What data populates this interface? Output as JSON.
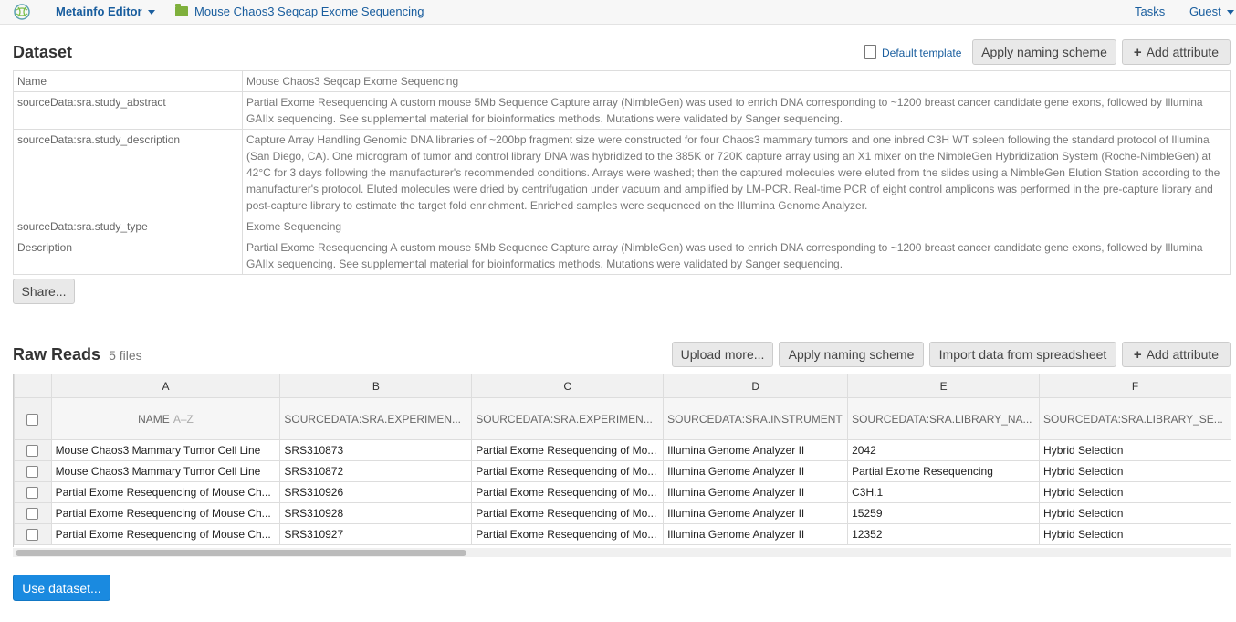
{
  "topbar": {
    "app_menu": "Metainfo Editor",
    "project": "Mouse Chaos3 Seqcap Exome Sequencing",
    "tasks": "Tasks",
    "user": "Guest"
  },
  "dataset": {
    "title": "Dataset",
    "default_template": "Default template",
    "apply_naming": "Apply naming scheme",
    "add_attribute": "Add attribute",
    "attributes": [
      {
        "key": "Name",
        "value": "Mouse Chaos3 Seqcap Exome Sequencing"
      },
      {
        "key": "sourceData:sra.study_abstract",
        "value": "Partial Exome Resequencing A custom mouse 5Mb Sequence Capture array (NimbleGen) was used to enrich DNA corresponding to ~1200 breast cancer candidate gene exons, followed by Illumina GAIIx sequencing. See supplemental material for bioinformatics methods. Mutations were validated by Sanger sequencing."
      },
      {
        "key": "sourceData:sra.study_description",
        "value": "Capture Array Handling Genomic DNA libraries of ~200bp fragment size were constructed for four Chaos3 mammary tumors and one inbred C3H WT spleen following the standard protocol of Illumina (San Diego, CA). One microgram of tumor and control library DNA was hybridized to the 385K or 720K capture array using an X1 mixer on the NimbleGen Hybridization System (Roche-NimbleGen) at 42°C for 3 days following the manufacturer's recommended conditions. Arrays were washed; then the captured molecules were eluted from the slides using a NimbleGen Elution Station according to the manufacturer's protocol. Eluted molecules were dried by centrifugation under vacuum and amplified by LM-PCR. Real-time PCR of eight control amplicons was performed in the pre-capture library and post-capture library to estimate the target fold enrichment. Enriched samples were sequenced on the Illumina Genome Analyzer."
      },
      {
        "key": "sourceData:sra.study_type",
        "value": "Exome Sequencing"
      },
      {
        "key": "Description",
        "value": "Partial Exome Resequencing A custom mouse 5Mb Sequence Capture array (NimbleGen) was used to enrich DNA corresponding to ~1200 breast cancer candidate gene exons, followed by Illumina GAIIx sequencing. See supplemental material for bioinformatics methods. Mutations were validated by Sanger sequencing."
      }
    ],
    "share": "Share..."
  },
  "raw_reads": {
    "title": "Raw Reads",
    "count": "5 files",
    "upload": "Upload more...",
    "apply_naming": "Apply naming scheme",
    "import": "Import data from spreadsheet",
    "add_attribute": "Add attribute",
    "letters": [
      "A",
      "B",
      "C",
      "D",
      "E",
      "F"
    ],
    "name_header": "NAME",
    "sort_hint": "A–Z",
    "columns": [
      "SOURCEDATA:SRA.EXPERIMEN...",
      "SOURCEDATA:SRA.EXPERIMEN...",
      "SOURCEDATA:SRA.INSTRUMENT",
      "SOURCEDATA:SRA.LIBRARY_NA...",
      "SOURCEDATA:SRA.LIBRARY_SE..."
    ],
    "rows": [
      [
        "Mouse Chaos3 Mammary Tumor Cell Line",
        "SRS310873",
        "Partial Exome Resequencing of Mo...",
        "Illumina Genome Analyzer II",
        "2042",
        "Hybrid Selection"
      ],
      [
        "Mouse Chaos3 Mammary Tumor Cell Line",
        "SRS310872",
        "Partial Exome Resequencing of Mo...",
        "Illumina Genome Analyzer II",
        "Partial Exome Resequencing",
        "Hybrid Selection"
      ],
      [
        "Partial Exome Resequencing of Mouse Ch...",
        "SRS310926",
        "Partial Exome Resequencing of Mo...",
        "Illumina Genome Analyzer II",
        "C3H.1",
        "Hybrid Selection"
      ],
      [
        "Partial Exome Resequencing of Mouse Ch...",
        "SRS310928",
        "Partial Exome Resequencing of Mo...",
        "Illumina Genome Analyzer II",
        "15259",
        "Hybrid Selection"
      ],
      [
        "Partial Exome Resequencing of Mouse Ch...",
        "SRS310927",
        "Partial Exome Resequencing of Mo...",
        "Illumina Genome Analyzer II",
        "12352",
        "Hybrid Selection"
      ]
    ],
    "use_dataset": "Use dataset..."
  },
  "colors": {
    "link": "#1a5e9e",
    "primary_button": "#1a8ae0"
  }
}
